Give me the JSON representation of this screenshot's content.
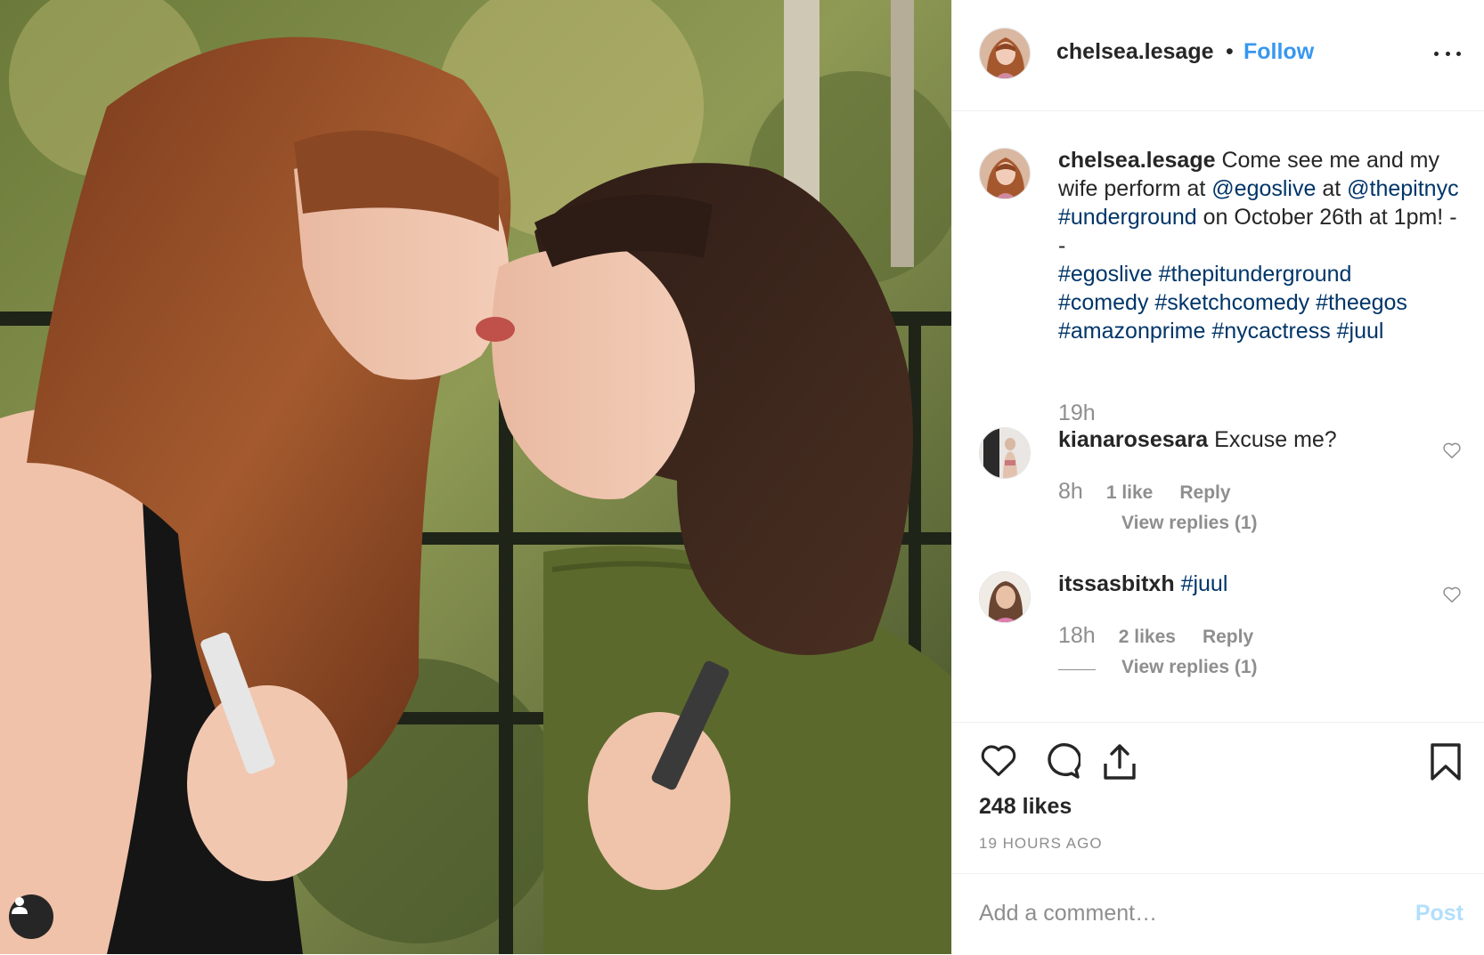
{
  "header": {
    "username": "chelsea.lesage",
    "separator": "•",
    "follow_label": "Follow"
  },
  "caption": {
    "username": "chelsea.lesage",
    "text_1": " Come see me and my wife perform at ",
    "mention_1": "@egoslive",
    "text_2": " at ",
    "mention_2": "@thepitnyc",
    "text_3": " ",
    "hashtag_1": "#underground",
    "text_4": " on October 26th at 1pm! -",
    "dash": "-",
    "hashtags": [
      "#egoslive",
      "#thepitunderground",
      "#comedy",
      "#sketchcomedy",
      "#theegos",
      "#amazonprime",
      "#nycactress",
      "#juul"
    ],
    "time": "19h"
  },
  "comments": [
    {
      "username": "kianarosesara",
      "text": "Excuse me?",
      "time": "8h",
      "likes": "1 like",
      "reply_label": "Reply",
      "view_replies": "View replies (1)"
    },
    {
      "username": "itssasbitxh",
      "text": "#juul",
      "time": "18h",
      "likes": "2 likes",
      "reply_label": "Reply",
      "view_replies": "View replies (1)"
    }
  ],
  "actions": {
    "icons": [
      "heart-icon",
      "comment-icon",
      "share-icon",
      "bookmark-icon"
    ],
    "likes_count": "248 likes",
    "time_ago": "19 HOURS AGO"
  },
  "add_comment": {
    "placeholder": "Add a comment…",
    "post_label": "Post"
  },
  "colors": {
    "link": "#003569",
    "follow": "#3897f0",
    "muted": "#8e8e8e",
    "post_disabled": "#b2dffc"
  }
}
